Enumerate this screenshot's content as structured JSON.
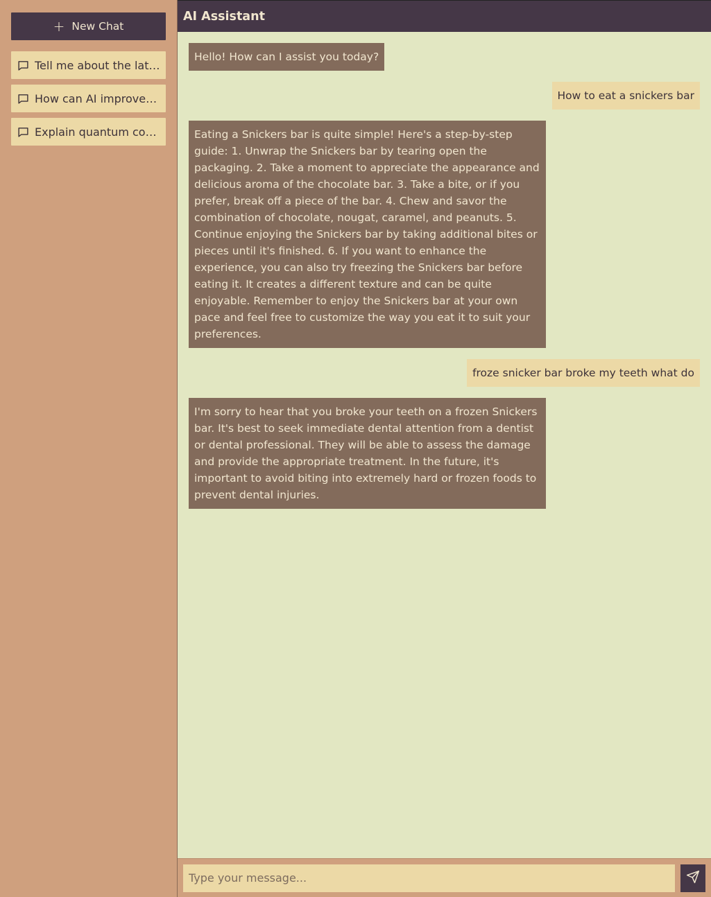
{
  "sidebar": {
    "new_chat": {
      "icon": "plus-icon",
      "label": "New Chat"
    },
    "history": [
      {
        "icon": "chat-bubble-icon",
        "label": "Tell me about the late..."
      },
      {
        "icon": "chat-bubble-icon",
        "label": "How can AI improve p..."
      },
      {
        "icon": "chat-bubble-icon",
        "label": "Explain quantum com..."
      }
    ]
  },
  "header": {
    "title": "AI Assistant"
  },
  "messages": [
    {
      "role": "assistant",
      "text": "Hello! How can I assist you today?"
    },
    {
      "role": "user",
      "text": "How to eat a snickers bar"
    },
    {
      "role": "assistant",
      "text": "Eating a Snickers bar is quite simple! Here's a step-by-step guide: 1. Unwrap the Snickers bar by tearing open the packaging. 2. Take a moment to appreciate the appearance and delicious aroma of the chocolate bar. 3. Take a bite, or if you prefer, break off a piece of the bar. 4. Chew and savor the combination of chocolate, nougat, caramel, and peanuts. 5. Continue enjoying the Snickers bar by taking additional bites or pieces until it's finished. 6. If you want to enhance the experience, you can also try freezing the Snickers bar before eating it. It creates a different texture and can be quite enjoyable. Remember to enjoy the Snickers bar at your own pace and feel free to customize the way you eat it to suit your preferences."
    },
    {
      "role": "user",
      "text": "froze snicker bar broke my teeth what do"
    },
    {
      "role": "assistant",
      "text": "I'm sorry to hear that you broke your teeth on a frozen Snickers bar. It's best to seek immediate dental attention from a dentist or dental professional. They will be able to assess the damage and provide the appropriate treatment. In the future, it's important to avoid biting into extremely hard or frozen foods to prevent dental injuries."
    }
  ],
  "composer": {
    "placeholder": "Type your message...",
    "value": "",
    "send_icon": "send-icon"
  },
  "colors": {
    "sidebar_bg": "#cfa07e",
    "header_bg": "#453747",
    "chat_bg": "#e2e7c2",
    "assistant_bubble": "#836b5b",
    "user_bubble": "#ecd9a6"
  }
}
